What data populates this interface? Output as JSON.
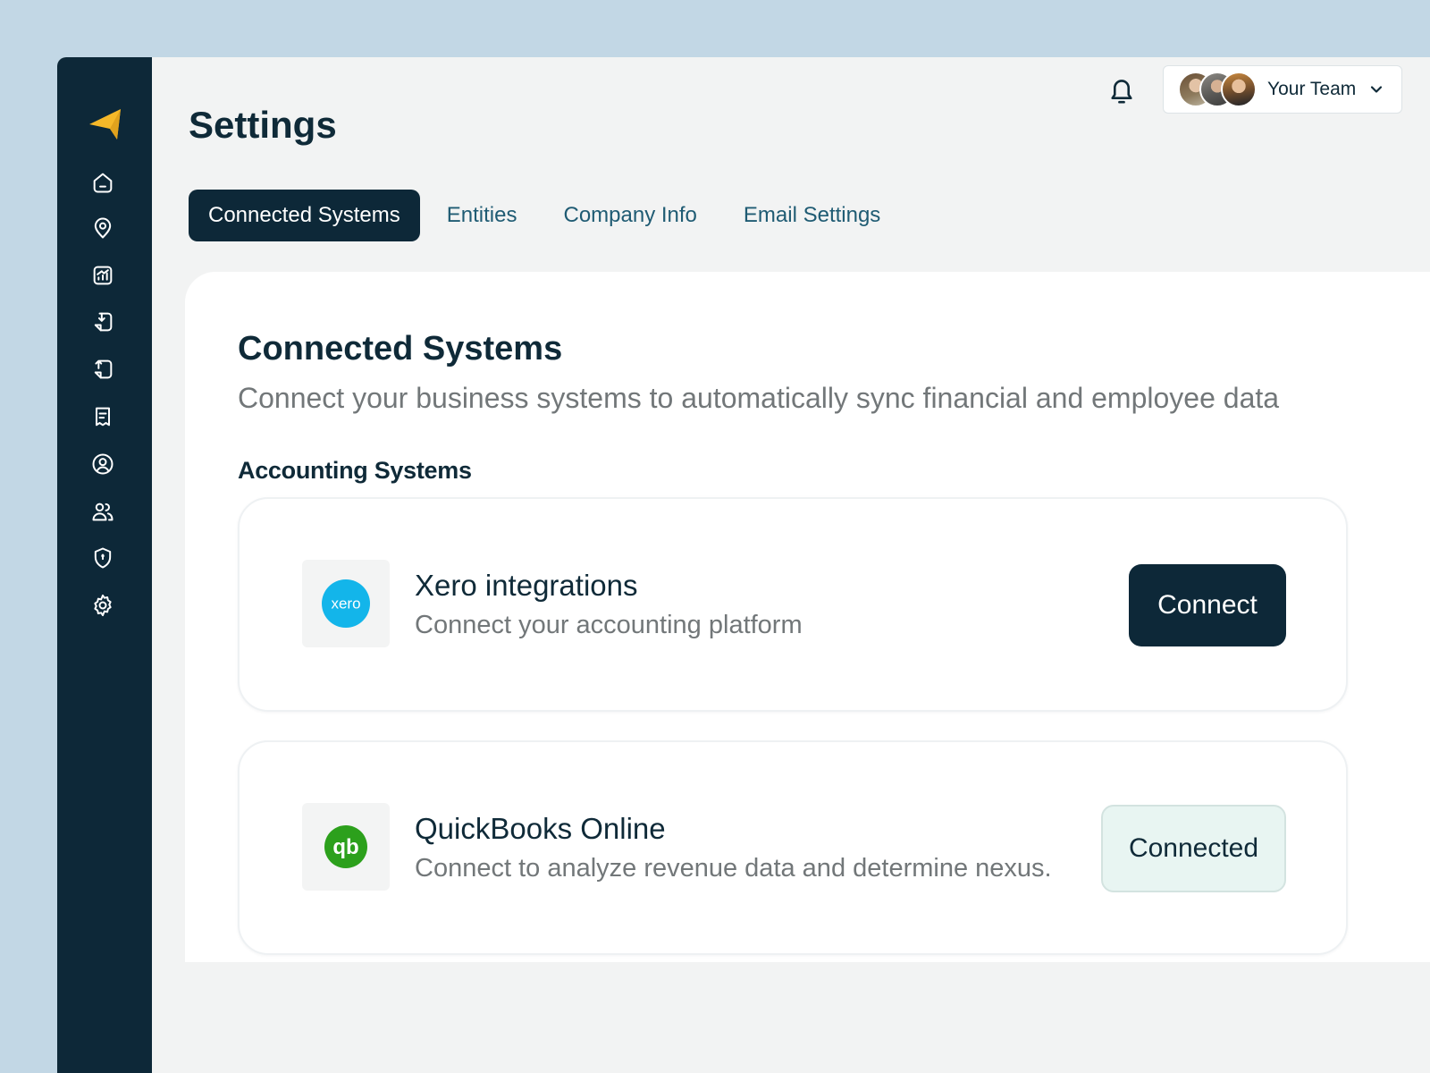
{
  "page": {
    "title": "Settings"
  },
  "header": {
    "team_label": "Your Team",
    "icons": [
      "bell-icon",
      "chevron-down-icon"
    ]
  },
  "sidebar": {
    "logo": "arrow-logo",
    "items": [
      {
        "name": "home",
        "icon": "home-icon"
      },
      {
        "name": "locations",
        "icon": "map-pin-icon"
      },
      {
        "name": "analytics",
        "icon": "chart-icon"
      },
      {
        "name": "import",
        "icon": "document-import-icon"
      },
      {
        "name": "export",
        "icon": "document-export-icon"
      },
      {
        "name": "reports",
        "icon": "receipt-icon"
      },
      {
        "name": "profile",
        "icon": "user-circle-icon"
      },
      {
        "name": "team",
        "icon": "users-icon"
      },
      {
        "name": "security",
        "icon": "shield-icon"
      },
      {
        "name": "settings",
        "icon": "gear-icon"
      }
    ]
  },
  "tabs": [
    {
      "label": "Connected Systems",
      "active": true
    },
    {
      "label": "Entities",
      "active": false
    },
    {
      "label": "Company Info",
      "active": false
    },
    {
      "label": "Email Settings",
      "active": false
    }
  ],
  "panel": {
    "title": "Connected Systems",
    "subtitle": "Connect your business systems to automatically sync financial and employee data",
    "section_title": "Accounting Systems",
    "integrations": [
      {
        "name": "Xero integrations",
        "description": "Connect your accounting platform",
        "logo_text": "xero",
        "button": "Connect",
        "status": "not_connected"
      },
      {
        "name": "QuickBooks Online",
        "description": "Connect to analyze revenue data and determine nexus.",
        "logo_text": "qb",
        "button": "Connected",
        "status": "connected"
      }
    ]
  },
  "colors": {
    "sidebar_bg": "#0d2838",
    "accent_logo": "#f5b829",
    "tab_text": "#1f5b73",
    "xero_blue": "#13b5ea",
    "quickbooks_green": "#2ca01c",
    "connected_bg": "#e8f5f2"
  }
}
